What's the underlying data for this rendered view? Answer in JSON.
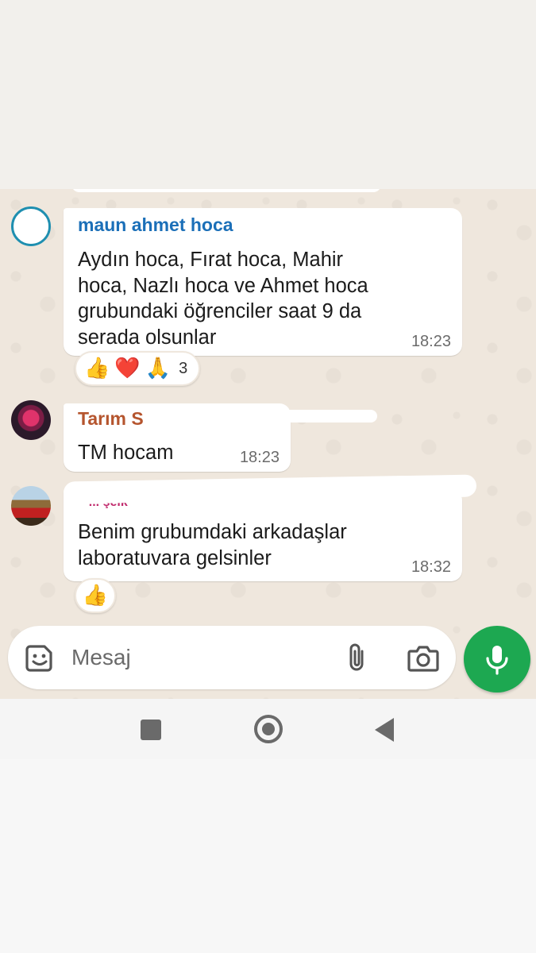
{
  "messages": [
    {
      "sender": "maun ahmet hoca",
      "text_lines": [
        "Aydın hoca, Fırat hoca, Mahir",
        "hoca, Nazlı hoca ve Ahmet hoca",
        "grubundaki öğrenciler saat 9 da",
        "serada olsunlar"
      ],
      "time": "18:23",
      "reactions": [
        "👍",
        "❤️",
        "🙏"
      ],
      "reaction_count": "3"
    },
    {
      "sender": "Tarım S",
      "text": "TM hocam",
      "time": "18:23"
    },
    {
      "sender": "^ ... şelk",
      "text_lines": [
        "Benim grubumdaki arkadaşlar",
        "laboratuvara gelsinler"
      ],
      "time": "18:32",
      "reactions": [
        "👍"
      ]
    }
  ],
  "composer": {
    "placeholder": "Mesaj"
  },
  "icons": {
    "sticker": "sticker-icon",
    "attach": "paperclip-icon",
    "camera": "camera-icon",
    "mic": "microphone-icon"
  },
  "colors": {
    "accent": "#1da851",
    "sender_1": "#1b6fb8",
    "sender_2": "#b5552e",
    "sender_3": "#c0286b"
  }
}
